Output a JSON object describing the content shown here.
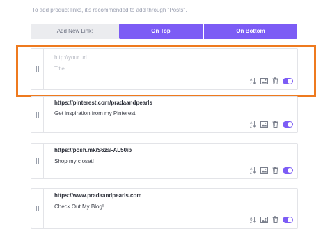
{
  "hint": "To add product links, it's recommended to add through \"Posts\".",
  "add_bar": {
    "label": "Add New Link:",
    "option_top": "On Top",
    "option_bottom": "On Bottom"
  },
  "colors": {
    "accent": "#7c5cf5",
    "highlight": "#ee7a1f"
  },
  "links": [
    {
      "url": "http://your url",
      "title": "Title",
      "placeholder": true,
      "enabled": true
    },
    {
      "url": "https://pinterest.com/pradaandpearls",
      "title": "Get inspiration from my Pinterest",
      "placeholder": false,
      "enabled": true
    },
    {
      "url": "https://posh.mk/S6zaFAL50ib",
      "title": "Shop my closet!",
      "placeholder": false,
      "enabled": true
    },
    {
      "url": "https://www.pradaandpearls.com",
      "title": "Check Out My Blog!",
      "placeholder": false,
      "enabled": true
    }
  ],
  "tool_icons": [
    "sort-az-icon",
    "image-icon",
    "trash-icon",
    "toggle-switch"
  ]
}
